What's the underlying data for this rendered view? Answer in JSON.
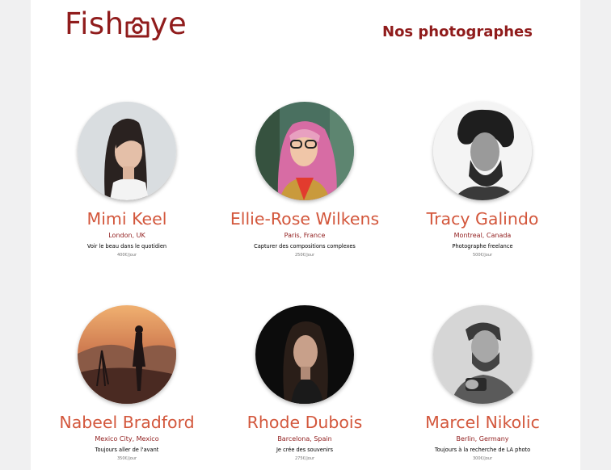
{
  "header": {
    "logo": {
      "before": "Fish",
      "after": "ye",
      "icon": "camera-icon"
    },
    "title": "Nos photographes"
  },
  "photographers": [
    {
      "name": "Mimi Keel",
      "location": "London, UK",
      "tagline": "Voir le beau dans le quotidien",
      "price": "400€/jour"
    },
    {
      "name": "Ellie-Rose Wilkens",
      "location": "Paris, France",
      "tagline": "Capturer des compositions complexes",
      "price": "250€/jour"
    },
    {
      "name": "Tracy Galindo",
      "location": "Montreal, Canada",
      "tagline": "Photographe freelance",
      "price": "500€/jour"
    },
    {
      "name": "Nabeel Bradford",
      "location": "Mexico City, Mexico",
      "tagline": "Toujours aller de l'avant",
      "price": "350€/jour"
    },
    {
      "name": "Rhode Dubois",
      "location": "Barcelona, Spain",
      "tagline": "Je crée des souvenirs",
      "price": "275€/jour"
    },
    {
      "name": "Marcel Nikolic",
      "location": "Berlin, Germany",
      "tagline": "Toujours à la recherche de LA photo",
      "price": "300€/jour"
    }
  ],
  "colors": {
    "primary": "#901c1c",
    "accent": "#d3573c",
    "background": "#ffffff"
  }
}
